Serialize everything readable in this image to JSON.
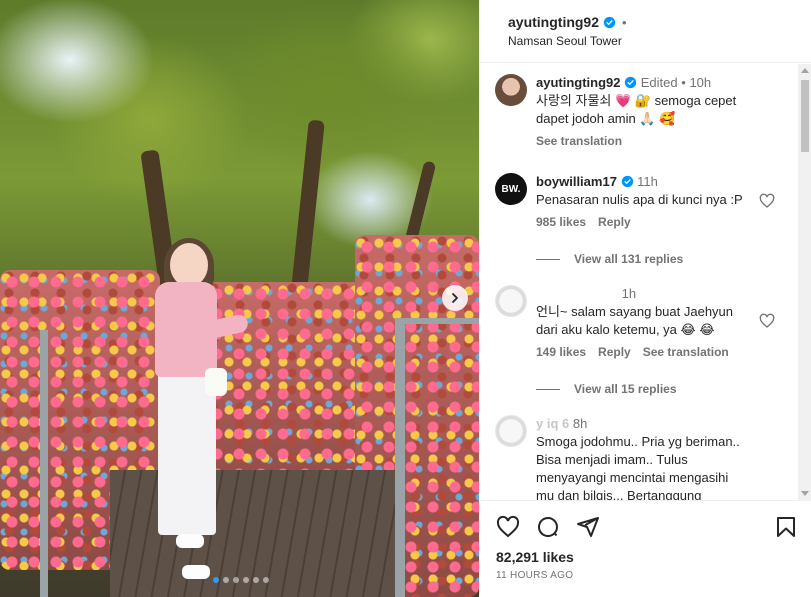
{
  "post": {
    "username": "ayutingting92",
    "follow_dot": "•",
    "location": "Namsan Seoul Tower",
    "carousel": {
      "slides": 6,
      "active_index": 0
    }
  },
  "caption": {
    "username": "ayutingting92",
    "edited": "Edited",
    "dot": "•",
    "time": "10h",
    "text_line1": "사랑의 자물쇠 💗 🔐 semoga cepet",
    "text_line2": "dapet jodoh amin 🙏🏻 🥰",
    "see_translation": "See translation"
  },
  "comments": [
    {
      "username": "boywilliam17",
      "time": "11h",
      "text": "Penasaran nulis apa di kunci nya :P",
      "likes": "985 likes",
      "reply": "Reply",
      "view_replies": "View all 131 replies",
      "avatar_text": "BW."
    },
    {
      "username": "",
      "time": "1h",
      "text_line1": "언니~ salam sayang buat Jaehyun",
      "text_line2": "dari aku kalo ketemu, ya 😂 😂",
      "likes": "149 likes",
      "reply": "Reply",
      "see_translation": "See translation",
      "view_replies": "View all 15 replies"
    },
    {
      "username": "y   iq   6",
      "time": "8h",
      "text_line1": "Smoga jodohmu.. Pria yg beriman..",
      "text_line2": "Bisa menjadi imam.. Tulus",
      "text_line3": "menyayangi mencintai mengasihi",
      "text_line4": "mu dan bilqis... Bertanggung"
    }
  ],
  "footer": {
    "likes": "82,291 likes",
    "time_ago": "11 HOURS AGO"
  },
  "colors": {
    "verified": "#0095f6",
    "text": "#262626",
    "muted": "#737373",
    "active_dot": "#3897f0"
  },
  "icons": {
    "like": "heart-icon",
    "comment": "comment-icon",
    "share": "share-icon",
    "save": "bookmark-icon",
    "next": "chevron-right-icon"
  }
}
